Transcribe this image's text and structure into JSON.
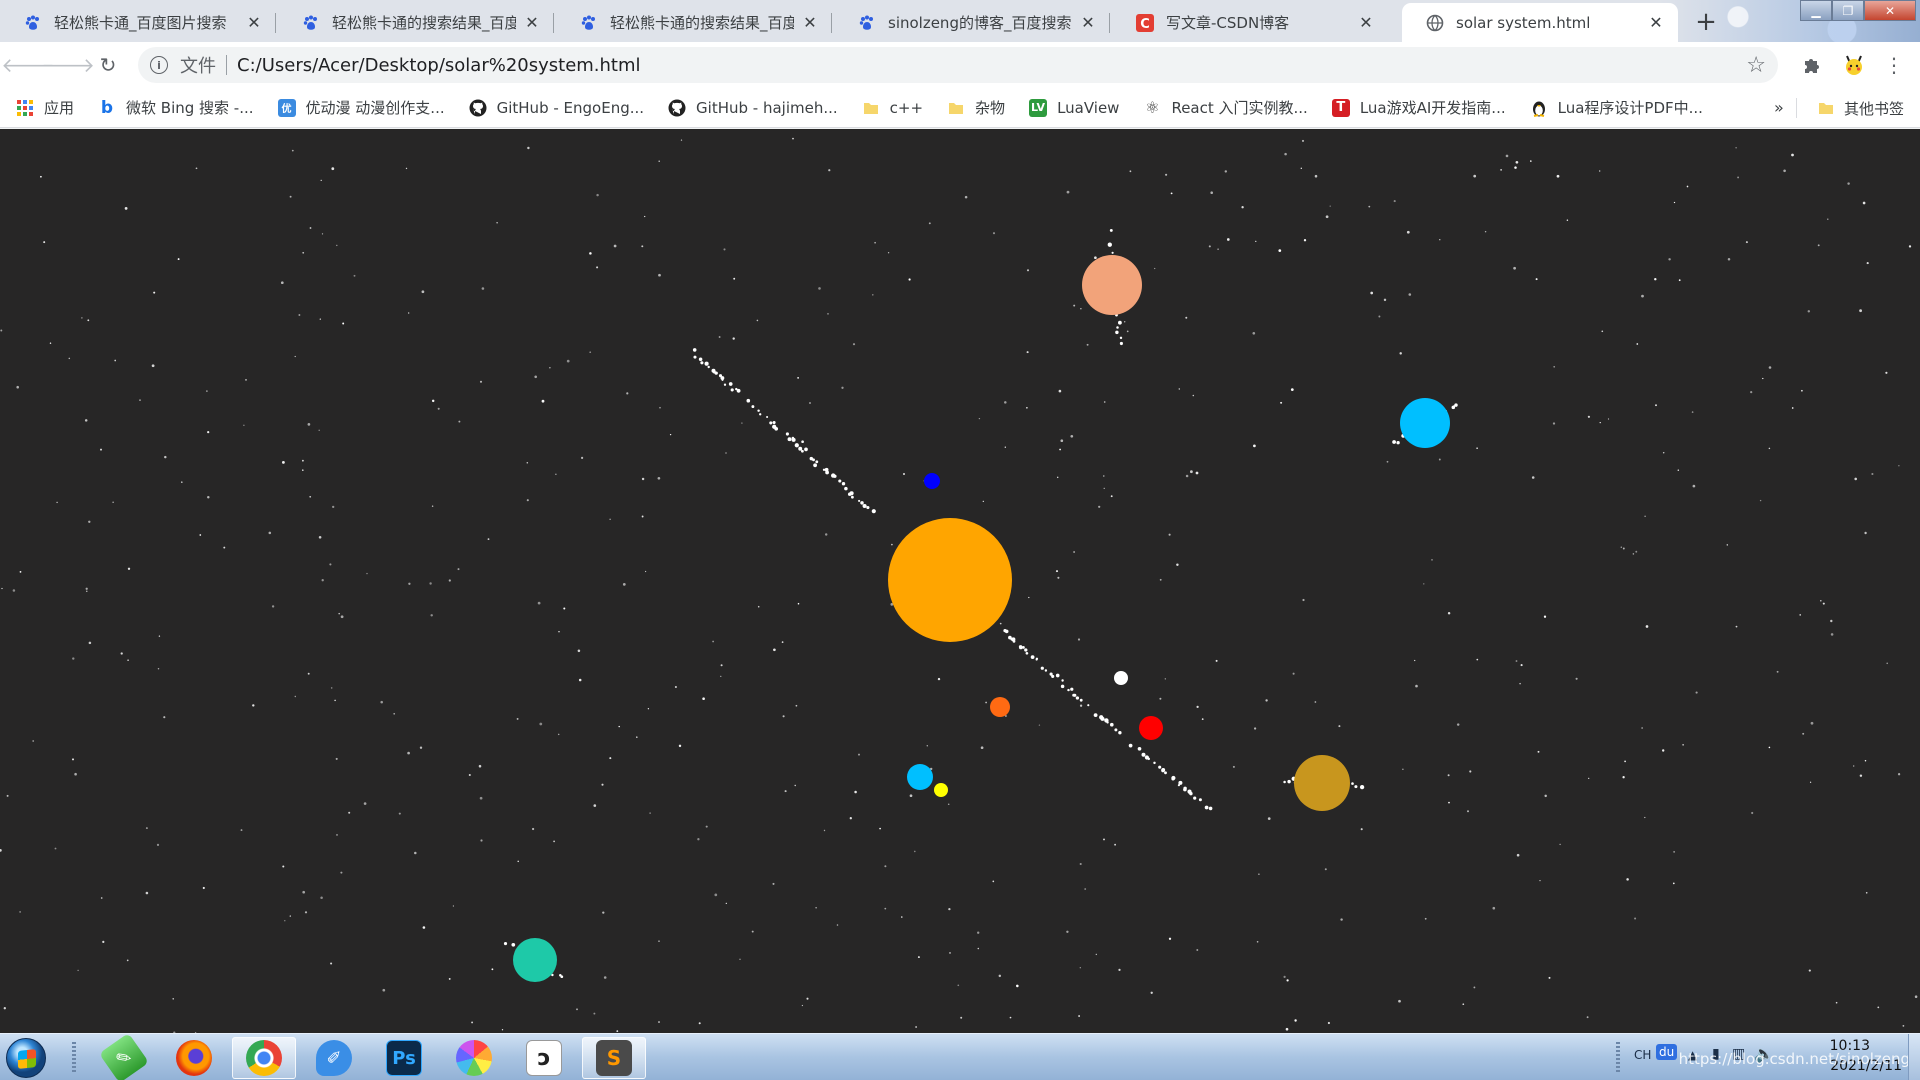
{
  "tabs": [
    {
      "title": "轻松熊卡通_百度图片搜索",
      "icon": "baidu-paw-icon",
      "active": false
    },
    {
      "title": "轻松熊卡通的搜索结果_百度图",
      "icon": "baidu-paw-icon",
      "active": false
    },
    {
      "title": "轻松熊卡通的搜索结果_百度图",
      "icon": "baidu-paw-icon",
      "active": false
    },
    {
      "title": "sinolzeng的博客_百度搜索",
      "icon": "baidu-paw-icon",
      "active": false
    },
    {
      "title": "写文章-CSDN博客",
      "icon": "csdn-icon",
      "active": false
    },
    {
      "title": "solar system.html",
      "icon": "globe-icon",
      "active": true
    }
  ],
  "toolbar": {
    "scheme_label": "文件",
    "url": "C:/Users/Acer/Desktop/solar%20system.html"
  },
  "bookmarks": [
    {
      "label": "应用",
      "icon": "apps-grid-icon"
    },
    {
      "label": "微软 Bing 搜索 -...",
      "icon": "bing-icon"
    },
    {
      "label": "优动漫 动漫创作支...",
      "icon": "youdongman-icon"
    },
    {
      "label": "GitHub - EngoEng...",
      "icon": "github-icon"
    },
    {
      "label": "GitHub - hajimeh...",
      "icon": "github-icon"
    },
    {
      "label": "c++",
      "icon": "folder-icon"
    },
    {
      "label": "杂物",
      "icon": "folder-icon"
    },
    {
      "label": "LuaView",
      "icon": "luaview-icon"
    },
    {
      "label": "React 入门实例教...",
      "icon": "react-icon"
    },
    {
      "label": "Lua游戏AI开发指南...",
      "icon": "t-icon"
    },
    {
      "label": "Lua程序设计PDF中...",
      "icon": "penguin-icon"
    }
  ],
  "bookmarks_more": "»",
  "bookmarks_other": "其他书签",
  "scene": {
    "background": "#272626",
    "sun": {
      "color": "#ffa500"
    },
    "planet_colors": [
      "#0000ff",
      "#ff6a13",
      "#00bfff",
      "#ffff00",
      "#ffffff",
      "#ff0000",
      "#c8961e",
      "#00bfff",
      "#f2a37a",
      "#1ec9a8"
    ]
  },
  "taskbar": {
    "apps": [
      {
        "name": "green-pen-app",
        "color": "#3db23d",
        "glyph": "✎",
        "active": false
      },
      {
        "name": "firefox-app",
        "color": "#e8661a",
        "glyph": "",
        "active": false
      },
      {
        "name": "chrome-app",
        "color": "#ffffff",
        "glyph": "",
        "active": true
      },
      {
        "name": "note-app",
        "color": "#3a8ee6",
        "glyph": "✐",
        "active": false
      },
      {
        "name": "photoshop-app",
        "color": "#0b2a4a",
        "glyph": "Ps",
        "active": false
      },
      {
        "name": "color-wheel-app",
        "color": "#ffffff",
        "glyph": "",
        "active": false
      },
      {
        "name": "clip-studio-app",
        "color": "#ffffff",
        "glyph": "",
        "active": false
      },
      {
        "name": "sublime-text-app",
        "color": "#4a4a4a",
        "glyph": "S",
        "active": true
      }
    ],
    "ime_label": "CH",
    "baidu_ime_label": "du",
    "time": "10:13",
    "date": "2021/2/11",
    "watermark": "https://blog.csdn.net/sinolzeng"
  }
}
